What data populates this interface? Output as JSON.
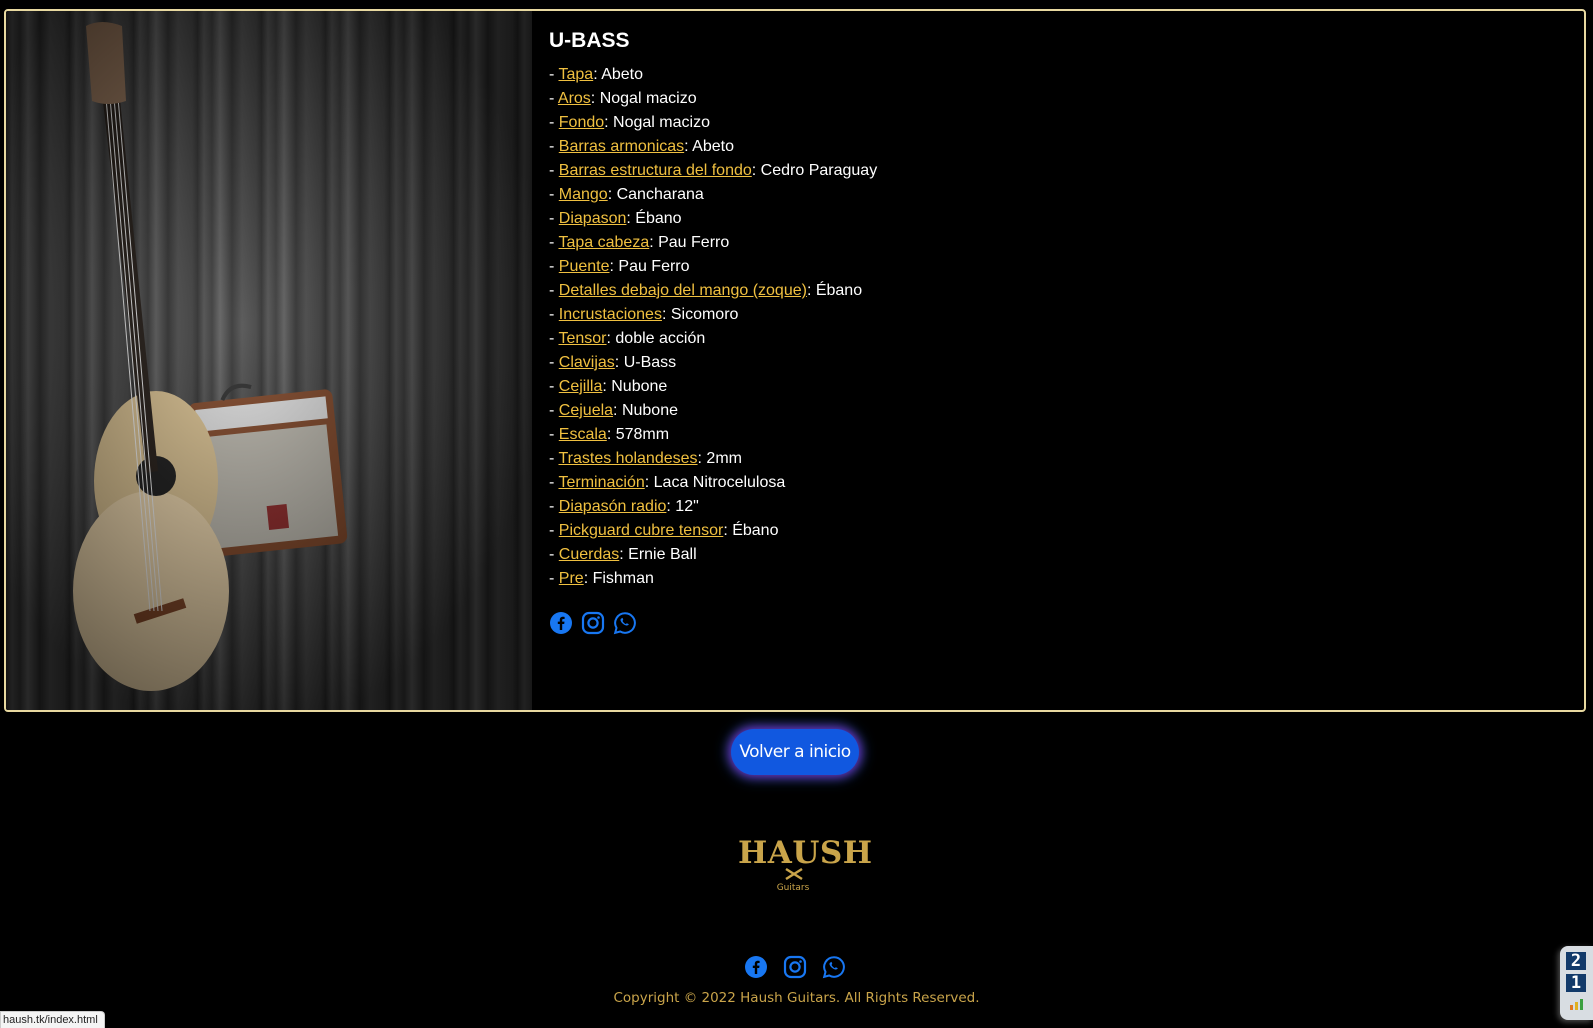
{
  "product": {
    "title": "U-BASS",
    "specs": [
      {
        "prefix": "- ",
        "label": "Tapa",
        "value": ": Abeto"
      },
      {
        "prefix": "- ",
        "label": "Aros",
        "value": ": Nogal macizo"
      },
      {
        "prefix": "- ",
        "label": "Fondo",
        "value": ": Nogal macizo"
      },
      {
        "prefix": "- ",
        "label": "Barras armonicas",
        "value": ": Abeto"
      },
      {
        "prefix": "- ",
        "label": "Barras estructura del fondo",
        "value": ": Cedro Paraguay"
      },
      {
        "prefix": "- ",
        "label": "Mango",
        "value": ": Cancharana"
      },
      {
        "prefix": "- ",
        "label": "Diapason",
        "value": ": Ébano"
      },
      {
        "prefix": "- ",
        "label": "Tapa cabeza",
        "value": ": Pau Ferro"
      },
      {
        "prefix": "- ",
        "label": "Puente",
        "value": ": Pau Ferro"
      },
      {
        "prefix": "- ",
        "label": "Detalles debajo del mango (zoque)",
        "value": ": Ébano"
      },
      {
        "prefix": "- ",
        "label": "Incrustaciones",
        "value": ": Sicomoro"
      },
      {
        "prefix": "- ",
        "label": "Tensor",
        "value": ": doble acción"
      },
      {
        "prefix": "- ",
        "label": "Clavijas",
        "value": ": U-Bass"
      },
      {
        "prefix": "- ",
        "label": "Cejilla",
        "value": ": Nubone"
      },
      {
        "prefix": "- ",
        "label": "Cejuela",
        "value": ": Nubone"
      },
      {
        "prefix": "- ",
        "label": "Escala",
        "value": ": 578mm"
      },
      {
        "prefix": "- ",
        "label": "Trastes holandeses",
        "value": ": 2mm"
      },
      {
        "prefix": "- ",
        "label": "Terminación",
        "value": ": Laca Nitrocelulosa"
      },
      {
        "prefix": "- ",
        "label": "Diapasón radio",
        "value": ": 12\""
      },
      {
        "prefix": "- ",
        "label": "Pickguard cubre tensor",
        "value": ": Ébano"
      },
      {
        "prefix": "- ",
        "label": "Cuerdas",
        "value": ": Ernie Ball"
      },
      {
        "prefix": "- ",
        "label": "Pre",
        "value": ": Fishman"
      }
    ],
    "social_icons": [
      "facebook-icon",
      "instagram-icon",
      "whatsapp-icon"
    ]
  },
  "back_button": {
    "label": "Volver a inicio"
  },
  "footer": {
    "logo_text": "HAUSH",
    "logo_sub": "Guitars",
    "social_icons": [
      "facebook-icon",
      "instagram-icon",
      "whatsapp-icon"
    ],
    "copyright": "Copyright © 2022 Haush Guitars. All Rights Reserved."
  },
  "status_bar": {
    "url": "haush.tk/index.html"
  },
  "widget": {
    "top_digit": "2",
    "bottom_digit": "1"
  },
  "colors": {
    "accent_link": "#f0c040",
    "card_border": "#e8d9a0",
    "social_blue": "#1877f2",
    "button_blue": "#1158e0",
    "gold": "#c9a44a"
  }
}
